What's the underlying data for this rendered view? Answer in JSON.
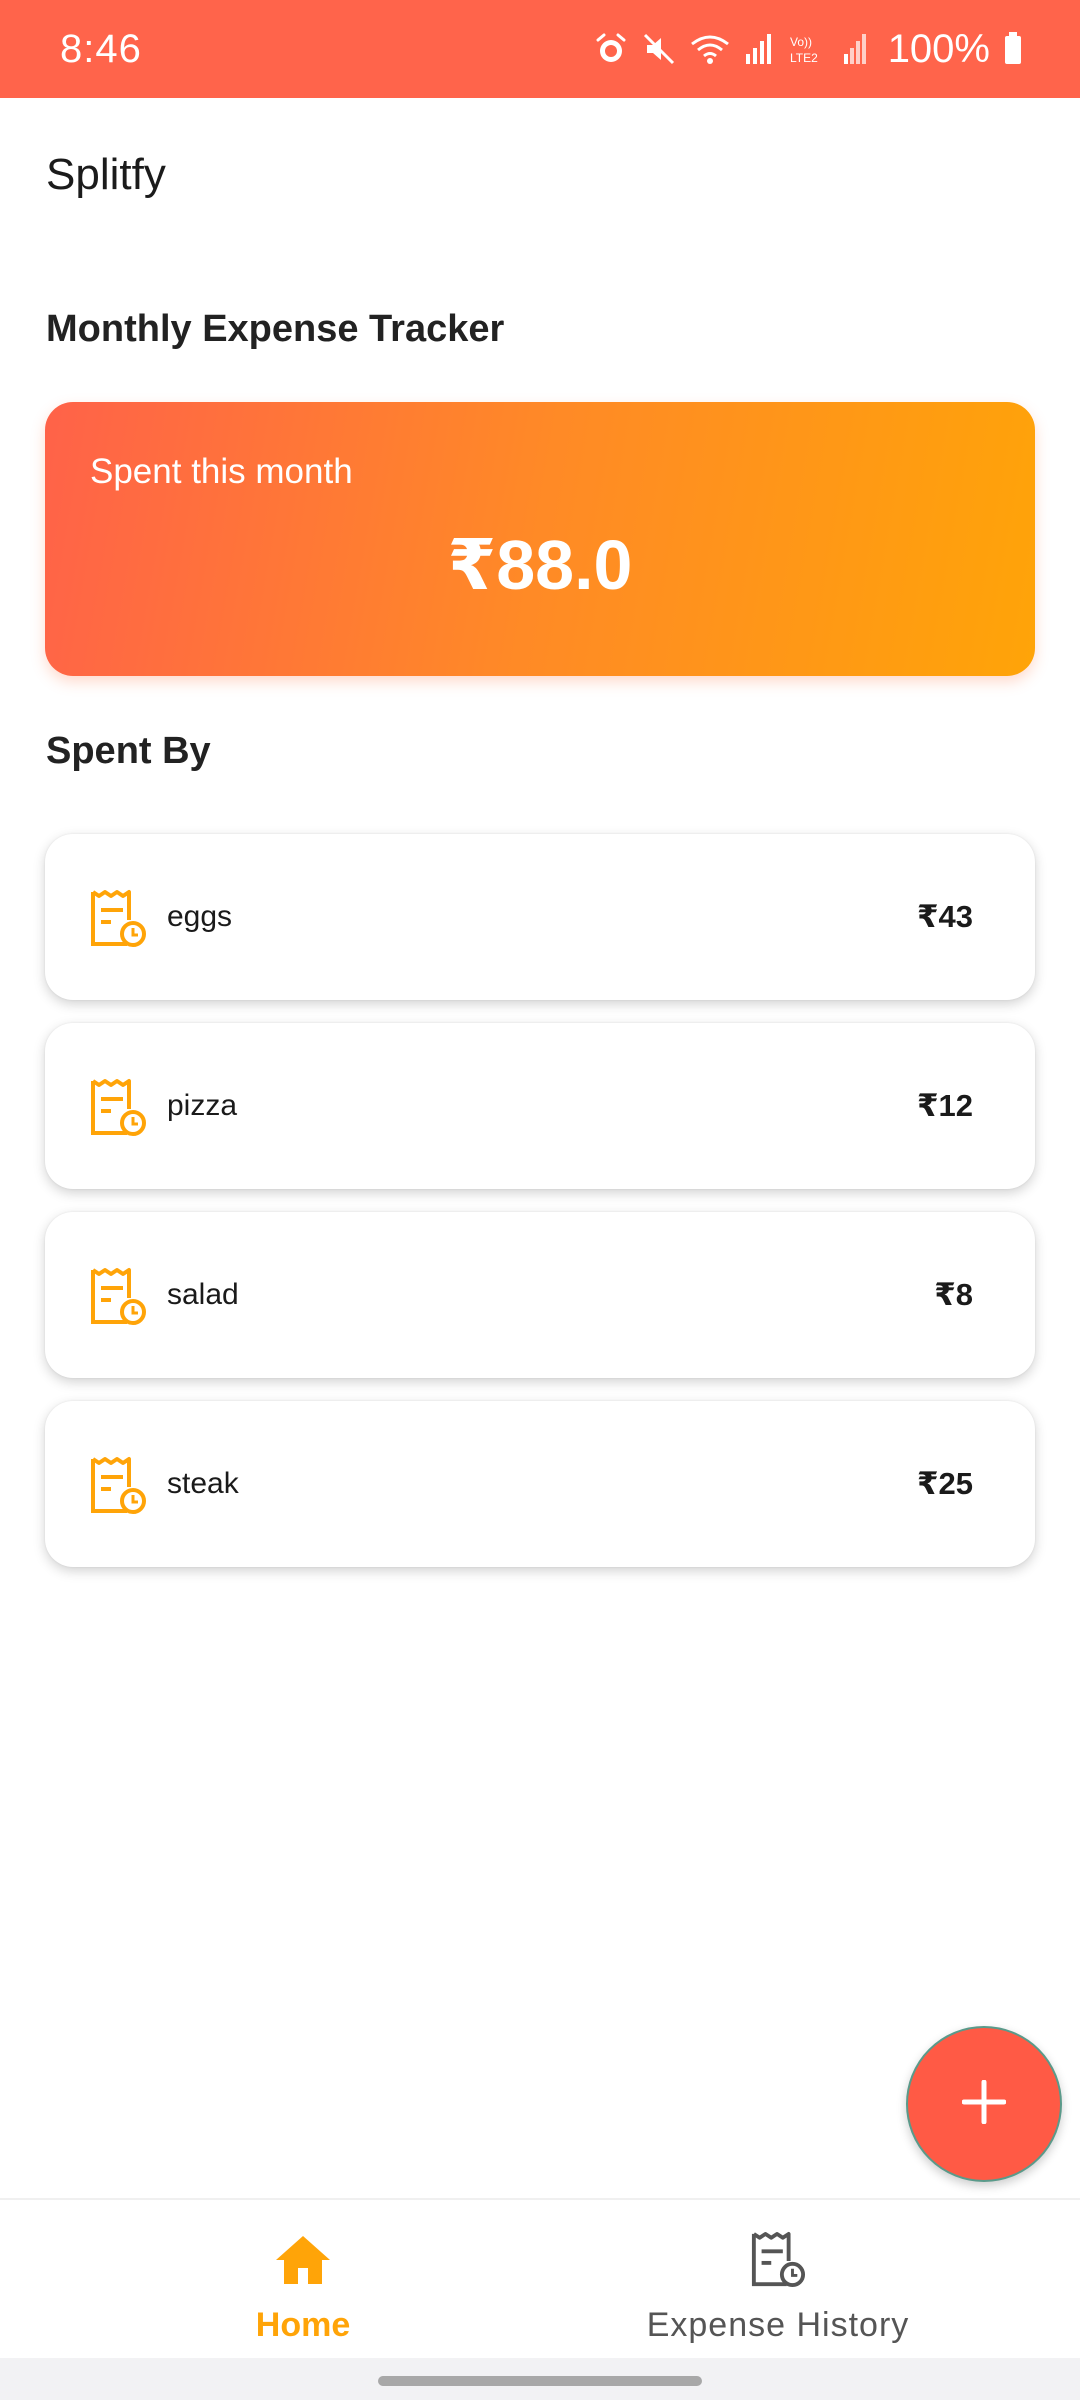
{
  "status_bar": {
    "time": "8:46",
    "battery": "100%",
    "icons": [
      "alarm-icon",
      "mute-icon",
      "wifi-icon",
      "signal-icon",
      "volte-icon",
      "signal-weak-icon",
      "battery-icon"
    ]
  },
  "app": {
    "title": "Splitfy"
  },
  "tracker": {
    "heading": "Monthly Expense Tracker",
    "card_label": "Spent this month",
    "card_amount": "₹88.0"
  },
  "spent_by": {
    "heading": "Spent By",
    "items": [
      {
        "name": "eggs",
        "amount": "₹43"
      },
      {
        "name": "pizza",
        "amount": "₹12"
      },
      {
        "name": "salad",
        "amount": "₹8"
      },
      {
        "name": "steak",
        "amount": "₹25"
      }
    ]
  },
  "fab": {
    "icon": "plus-icon"
  },
  "bottom_nav": {
    "items": [
      {
        "label": "Home",
        "icon": "home-icon",
        "active": true
      },
      {
        "label": "Expense History",
        "icon": "receipt-clock-icon",
        "active": false
      }
    ]
  },
  "colors": {
    "accent": "#ff644b",
    "accent_orange": "#ffa408",
    "text": "#1a1a1a"
  }
}
